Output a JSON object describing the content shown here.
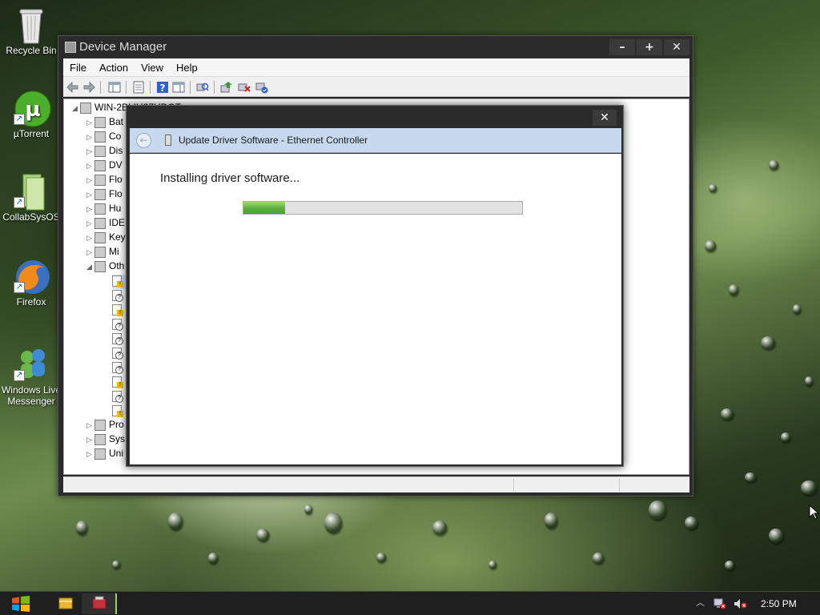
{
  "desktop": {
    "icons": [
      {
        "label": "Recycle Bin",
        "icon": "recycle-bin-icon"
      },
      {
        "label": "µTorrent",
        "icon": "utorrent-icon"
      },
      {
        "label": "CollabSysOS",
        "icon": "file-icon"
      },
      {
        "label": "Firefox",
        "icon": "firefox-icon"
      },
      {
        "label": "Windows Live Messenger",
        "icon": "messenger-icon"
      }
    ]
  },
  "device_manager": {
    "title": "Device Manager",
    "window_buttons": {
      "minimize": "–",
      "maximize": "+",
      "close": "✕"
    },
    "menu": [
      "File",
      "Action",
      "View",
      "Help"
    ],
    "tree": {
      "root": "WIN-2BLIU37UDOT",
      "categories": [
        "Bat",
        "Co",
        "Dis",
        "DV",
        "Flo",
        "Flo",
        "Hu",
        "IDE",
        "Key",
        "Mi",
        "Oth",
        "Pro",
        "Sys",
        "Uni"
      ]
    }
  },
  "dialog": {
    "close": "✕",
    "title": "Update Driver Software - Ethernet Controller",
    "message": "Installing driver software...",
    "progress": 0.15,
    "back_glyph": "←"
  },
  "taskbar": {
    "clock": "2:50 PM",
    "tray_chevron": "︿"
  },
  "colors": {
    "progress_fill": "#5fb33c",
    "dialog_header": "#c6d9ee",
    "titlebar": "#2b2b2b"
  }
}
